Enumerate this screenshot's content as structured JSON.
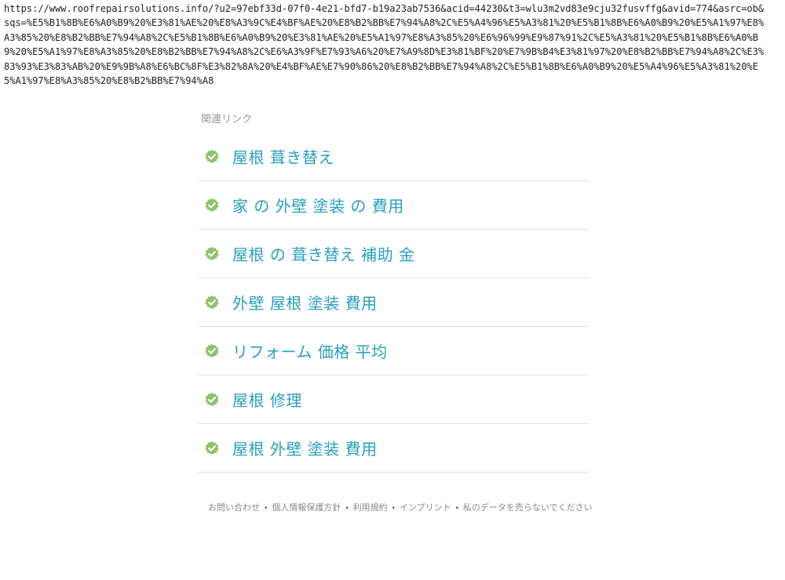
{
  "url": {
    "text": "https://www.roofrepairsolutions.info/?u2=97ebf33d-07f0-4e21-bfd7-b19a23ab7536&acid=44230&t3=wlu3m2vd83e9cju32fusvffg&avid=774&asrc=ob&sqs=%E5%B1%8B%E6%A0%B9%20%E3%81%AE%20%E8%A3%9C%E4%BF%AE%20%E8%B2%BB%E7%94%A8%2C%E5%A4%96%E5%A3%81%20%E5%B1%8B%E6%A0%B9%20%E5%A1%97%E8%A3%85%20%E8%B2%BB%E7%94%A8%2C%E5%B1%8B%E6%A0%B9%20%E3%81%AE%20%E5%A1%97%E8%A3%85%20%E6%96%99%E9%87%91%2C%E5%A3%81%20%E5%B1%8B%E6%A0%B9%20%E5%A1%97%E8%A3%85%20%E8%B2%BB%E7%94%A8%2C%E6%A3%9F%E7%93%A6%20%E7%A9%8D%E3%81%BF%20%E7%9B%B4%E3%81%97%20%E8%B2%BB%E7%94%A8%2C%E3%83%93%E3%83%AB%20%E9%9B%A8%E6%BC%8F%E3%82%8A%20%E4%BF%AE%E7%90%86%20%E8%B2%BB%E7%94%A8%2C%E5%B1%8B%E6%A0%B9%20%E5%A4%96%E5%A3%81%20%E5%A1%97%E8%A3%85%20%E8%B2%BB%E7%94%A8"
  },
  "related": {
    "heading": "関連リンク",
    "icon": "check-badge-icon",
    "icon_color": "#8dc46a",
    "link_color": "#2a9fc0",
    "items": [
      {
        "label": "屋根 葺き替え"
      },
      {
        "label": "家 の 外壁 塗装 の 費用"
      },
      {
        "label": "屋根 の 葺き替え 補助 金"
      },
      {
        "label": "外壁 屋根 塗装 費用"
      },
      {
        "label": "リフォーム 価格 平均"
      },
      {
        "label": "屋根 修理"
      },
      {
        "label": "屋根 外壁 塗装 費用"
      }
    ]
  },
  "footer": {
    "separator": "•",
    "links": [
      {
        "label": "お問い合わせ"
      },
      {
        "label": "個人情報保護方針"
      },
      {
        "label": "利用規約"
      },
      {
        "label": "インプリント"
      },
      {
        "label": "私のデータを売らないでください"
      }
    ]
  }
}
